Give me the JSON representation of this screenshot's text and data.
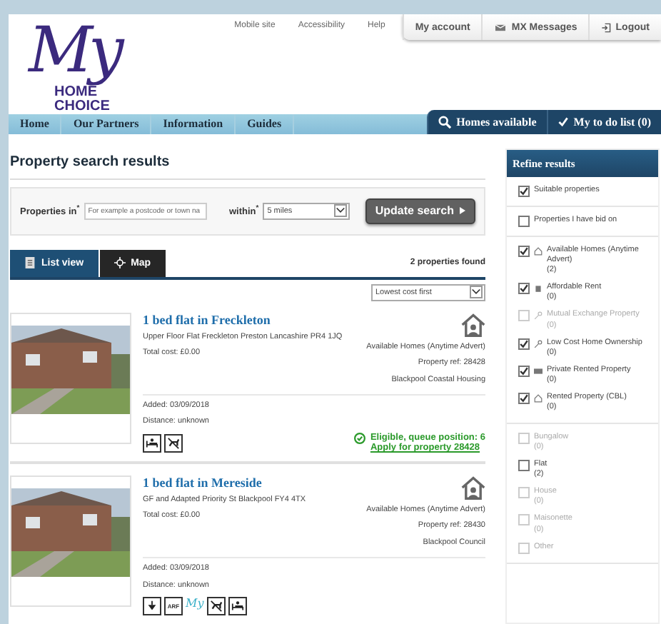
{
  "logo": {
    "script": "My",
    "lines": [
      "HOME",
      "CHOICE"
    ]
  },
  "top_links": [
    "Mobile site",
    "Accessibility",
    "Help"
  ],
  "account_tabs": [
    {
      "kind": "plain",
      "label": "My account"
    },
    {
      "kind": "mail",
      "label": "MX Messages"
    },
    {
      "kind": "logout",
      "label": "Logout"
    }
  ],
  "nav": [
    "Home",
    "Our Partners",
    "Information",
    "Guides"
  ],
  "nav_actions": [
    {
      "kind": "search",
      "label": "Homes available"
    },
    {
      "kind": "check",
      "label": "My to do list (0)"
    }
  ],
  "page_title": "Property search results",
  "search": {
    "label": "Properties in",
    "required": "*",
    "placeholder": "For example a postcode or town na",
    "within_label": "within",
    "within_required": "*",
    "within_value": "5 miles",
    "button": "Update search"
  },
  "view_tabs": [
    {
      "kind": "list",
      "label": "List view",
      "selected": true
    },
    {
      "kind": "map",
      "label": "Map",
      "selected": false
    }
  ],
  "found": "2 properties found",
  "sort": "Lowest cost first",
  "properties": [
    {
      "title": "1 bed flat in Freckleton",
      "address": "Upper Floor Flat Freckleton Preston Lancashire PR4 1JQ",
      "cost": "Total cost: £0.00",
      "type": "Available Homes (Anytime Advert)",
      "ref": "Property ref: 28428",
      "landlord": "Blackpool Coastal Housing",
      "added": "Added: 03/09/2018",
      "distance": "Distance: unknown",
      "features": [
        {
          "kind": "bed"
        },
        {
          "kind": "no-pets"
        }
      ],
      "eligibility": "Eligible, queue position: 6",
      "apply": "Apply for property 28428"
    },
    {
      "title": "1 bed flat in Mereside",
      "address": "GF and Adapted Priority St Blackpool FY4 4TX",
      "cost": "Total cost: £0.00",
      "type": "Available Homes (Anytime Advert)",
      "ref": "Property ref: 28430",
      "landlord": "Blackpool Council",
      "added": "Added: 03/09/2018",
      "distance": "Distance: unknown",
      "features": [
        {
          "kind": "lift"
        },
        {
          "kind": "text",
          "label": "ARF"
        },
        {
          "kind": "brand",
          "label": "My"
        },
        {
          "kind": "no-pets"
        },
        {
          "kind": "bed"
        }
      ]
    }
  ],
  "refine": {
    "title": "Refine results",
    "groups": [
      [
        {
          "label": "Suitable properties",
          "checked": true,
          "disabled": false
        }
      ],
      [
        {
          "label": "Properties I have bid on",
          "checked": false,
          "disabled": false
        }
      ],
      [
        {
          "label": "Available Homes (Anytime Advert)",
          "count": "(2)",
          "kind": "house",
          "checked": true,
          "disabled": false
        },
        {
          "label": "Affordable Rent",
          "count": "(0)",
          "kind": "building",
          "checked": true,
          "disabled": false
        },
        {
          "label": "Mutual Exchange Property",
          "count": "(0)",
          "kind": "key",
          "checked": false,
          "disabled": true
        },
        {
          "label": "Low Cost Home Ownership",
          "count": "(0)",
          "kind": "key",
          "checked": true,
          "disabled": false
        },
        {
          "label": "Private Rented Property",
          "count": "(0)",
          "kind": "card",
          "checked": true,
          "disabled": false
        },
        {
          "label": "Rented Property (CBL)",
          "count": "(0)",
          "kind": "house",
          "checked": true,
          "disabled": false
        }
      ],
      [
        {
          "label": "Bungalow",
          "count": "(0)",
          "checked": false,
          "disabled": true
        },
        {
          "label": "Flat",
          "count": "(2)",
          "checked": false,
          "disabled": false
        },
        {
          "label": "House",
          "count": "(0)",
          "checked": false,
          "disabled": true
        },
        {
          "label": "Maisonette",
          "count": "(0)",
          "checked": false,
          "disabled": true
        },
        {
          "label": "Other",
          "checked": false,
          "disabled": true
        }
      ]
    ]
  }
}
